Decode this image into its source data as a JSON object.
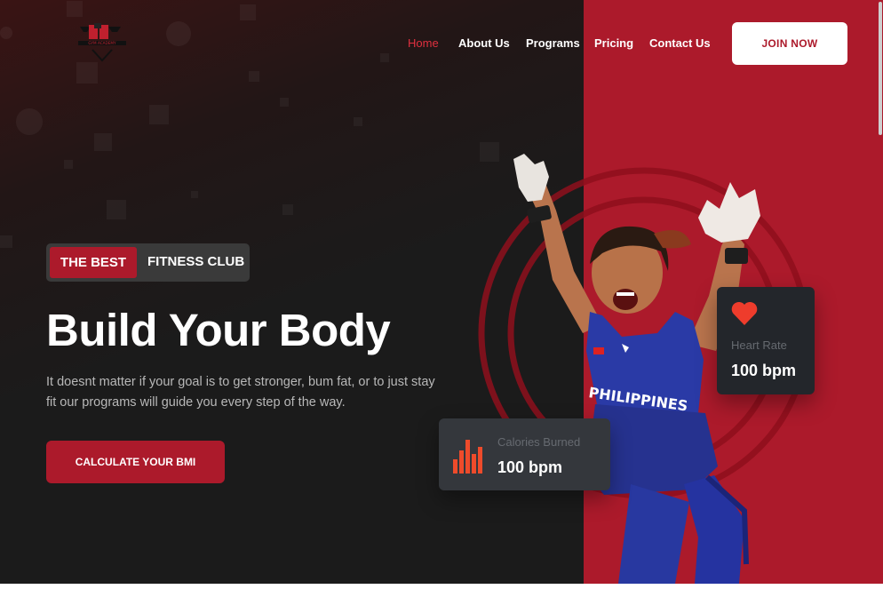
{
  "nav": {
    "items": [
      {
        "label": "Home",
        "active": true
      },
      {
        "label": "About Us",
        "active": false
      },
      {
        "label": "Programs",
        "active": false
      },
      {
        "label": "Pricing",
        "active": false
      },
      {
        "label": "Contact Us",
        "active": false
      }
    ],
    "cta_label": "JOIN NOW"
  },
  "logo": {
    "icon": "gym-logo-icon"
  },
  "hero": {
    "badge_highlight": "THE BEST",
    "badge_text": "FITNESS CLUB",
    "headline": "Build Your Body",
    "description": "It doesnt matter if your goal is to get stronger, bum fat, or to just stay fit our programs will guide you every step of the way.",
    "button_label": "CALCULATE YOUR BMI"
  },
  "stats": {
    "calories": {
      "label": "Calories Burned",
      "value": "100 bpm",
      "icon": "bar-chart-icon"
    },
    "heart_rate": {
      "label": "Heart Rate",
      "value": "100 bpm",
      "icon": "heart-icon"
    }
  },
  "athlete": {
    "jersey_text": "PHILIPPINES"
  },
  "colors": {
    "brand": "#ac1a2b",
    "active_link": "#e0303f",
    "dark_bg": "#1b1b1b",
    "icon_accent": "#ee4b2b"
  }
}
